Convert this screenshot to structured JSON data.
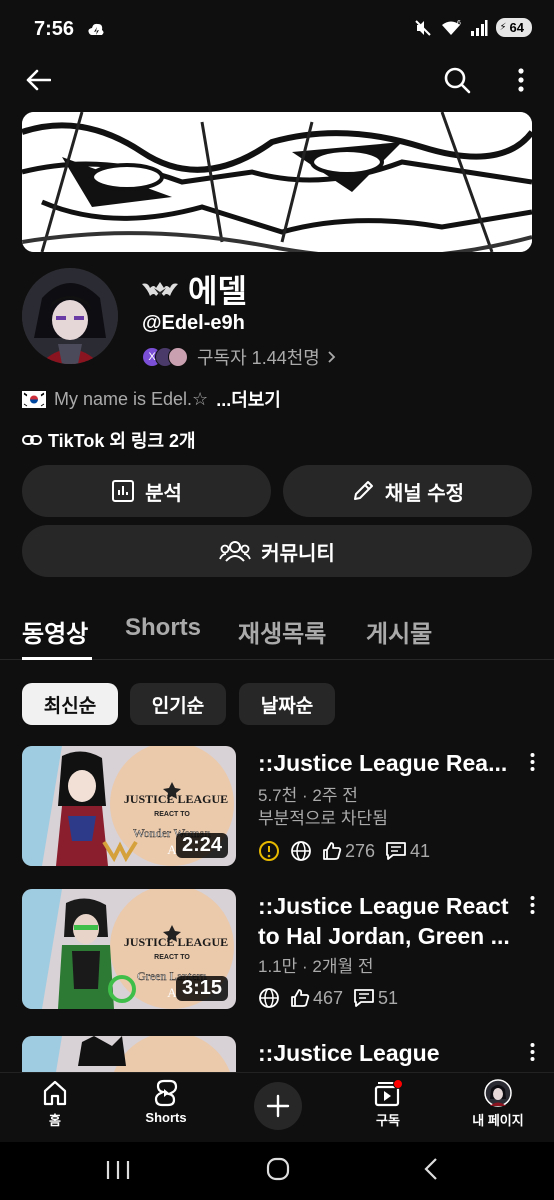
{
  "status": {
    "time": "7:56",
    "signal_label": "6",
    "battery": "64"
  },
  "channel": {
    "name": "에델",
    "handle": "@Edel-e9h",
    "subscribers": "구독자 1.44천명",
    "subs_badge": "X",
    "description": "My name is Edel.☆",
    "more": "...더보기",
    "links": "TikTok 외 링크 2개"
  },
  "buttons": {
    "analytics": "분석",
    "edit_channel": "채널 수정",
    "community": "커뮤니티"
  },
  "tabs": [
    "동영상",
    "Shorts",
    "재생목록",
    "게시물"
  ],
  "chips": [
    "최신순",
    "인기순",
    "날짜순"
  ],
  "videos": [
    {
      "title": "::Justice League Rea...",
      "meta1": "5.7천 · 2주 전",
      "meta2": "부분적으로 차단됨",
      "likes": "276",
      "comments": "41",
      "duration": "2:24",
      "thumb_title": "JUSTICE LEAGUE",
      "thumb_sub": "REACT TO",
      "thumb_subject": "Wonder Woman",
      "thumb_letter": "A",
      "accent": "#d4a13a"
    },
    {
      "title": "::Justice League React to Hal Jordan, Green ...",
      "meta1": "1.1만 · 2개월 전",
      "likes": "467",
      "comments": "51",
      "duration": "3:15",
      "thumb_title": "JUSTICE LEAGUE",
      "thumb_sub": "REACT TO",
      "thumb_subject": "Green Lantern",
      "thumb_letter": "A",
      "accent": "#3fbf4a"
    },
    {
      "title": "::Justice League"
    }
  ],
  "nav": {
    "home": "홈",
    "shorts": "Shorts",
    "subscriptions": "구독",
    "you": "내 페이지"
  }
}
